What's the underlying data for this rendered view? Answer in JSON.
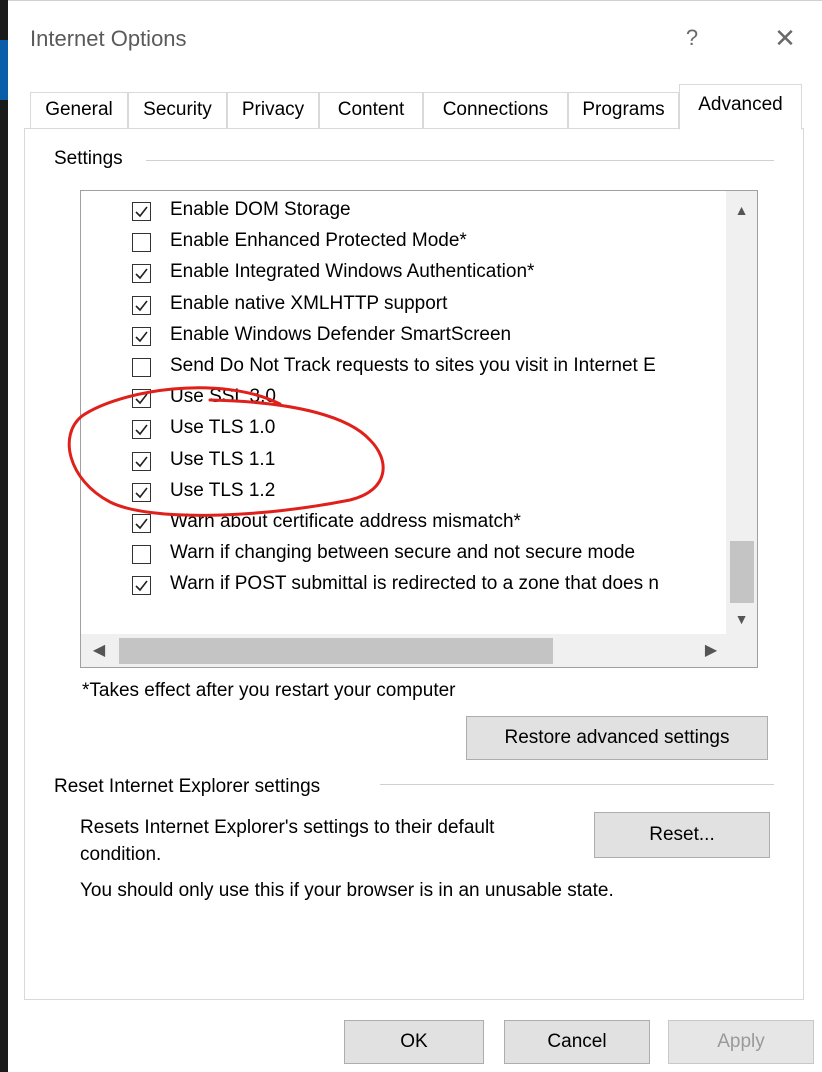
{
  "window": {
    "title": "Internet Options",
    "help_glyph": "?",
    "close_glyph": "✕"
  },
  "tabs": [
    {
      "label": "General"
    },
    {
      "label": "Security"
    },
    {
      "label": "Privacy"
    },
    {
      "label": "Content"
    },
    {
      "label": "Connections"
    },
    {
      "label": "Programs"
    },
    {
      "label": "Advanced",
      "active": true
    }
  ],
  "settings": {
    "group_label": "Settings",
    "items": [
      {
        "label": "Enable DOM Storage",
        "checked": true
      },
      {
        "label": "Enable Enhanced Protected Mode*",
        "checked": false
      },
      {
        "label": "Enable Integrated Windows Authentication*",
        "checked": true
      },
      {
        "label": "Enable native XMLHTTP support",
        "checked": true
      },
      {
        "label": "Enable Windows Defender SmartScreen",
        "checked": true
      },
      {
        "label": "Send Do Not Track requests to sites you visit in Internet E",
        "checked": false
      },
      {
        "label": "Use SSL 3.0",
        "checked": true
      },
      {
        "label": "Use TLS 1.0",
        "checked": true
      },
      {
        "label": "Use TLS 1.1",
        "checked": true
      },
      {
        "label": "Use TLS 1.2",
        "checked": true
      },
      {
        "label": "Warn about certificate address mismatch*",
        "checked": true
      },
      {
        "label": "Warn if changing between secure and not secure mode",
        "checked": false
      },
      {
        "label": "Warn if POST submittal is redirected to a zone that does n",
        "checked": true
      }
    ],
    "restart_note": "*Takes effect after you restart your computer",
    "restore_button": "Restore advanced settings"
  },
  "reset_group": {
    "label": "Reset Internet Explorer settings",
    "description_line1": "Resets Internet Explorer's settings to their default",
    "description_line2": "condition.",
    "reset_button": "Reset...",
    "warning": "You should only use this if your browser is in an unusable state."
  },
  "buttons": {
    "ok": "OK",
    "cancel": "Cancel",
    "apply": "Apply",
    "apply_disabled": true
  },
  "colors": {
    "annotation_red": "#e0201b",
    "button_face": "#e1e1e1",
    "scroll_thumb": "#c4c4c4"
  }
}
